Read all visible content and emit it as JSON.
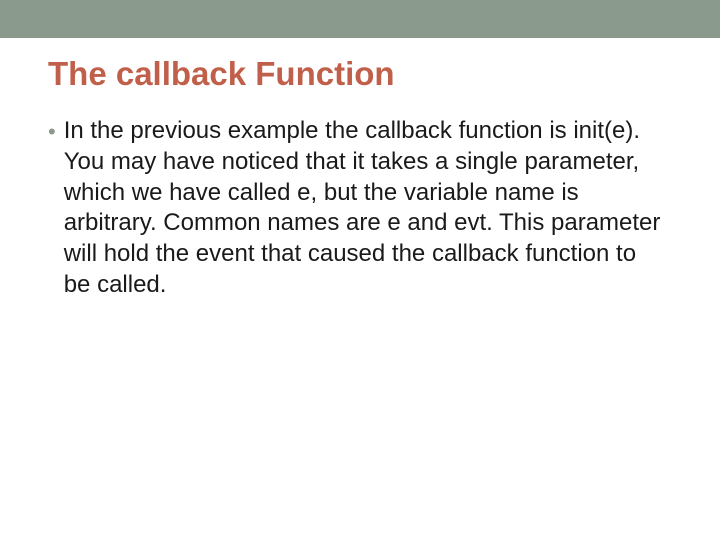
{
  "colors": {
    "accent_bar": "#8a9a8d",
    "title": "#c0604a",
    "bullet": "#8a9a8d",
    "body": "#1a1a1a"
  },
  "slide": {
    "title": "The callback Function",
    "bullet_glyph": "•",
    "body": "In the previous example the callback function is init(e). You may have noticed that it takes a single parameter, which we have called e, but the variable name is arbitrary. Common names are e and evt. This parameter will hold the event that caused the callback function to be called."
  }
}
